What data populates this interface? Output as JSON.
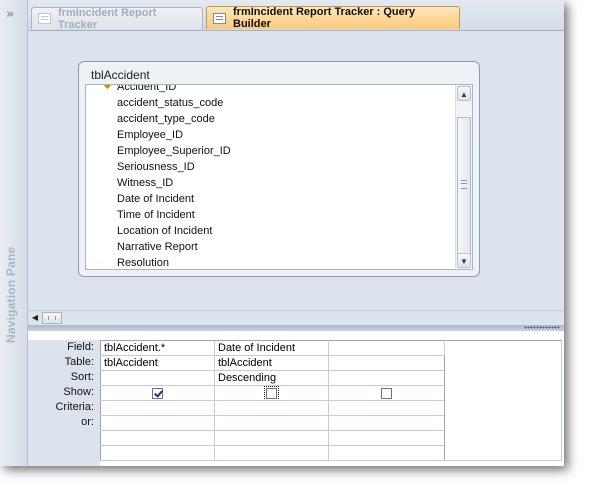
{
  "nav_pane": {
    "toggle_icon": "chevron-double-right-icon",
    "toggle_glyph": "»",
    "label": "Navigation Pane"
  },
  "tabs": [
    {
      "label": "frmIncident Report Tracker",
      "active": false,
      "icon": "form-icon"
    },
    {
      "label": "frmIncident Report Tracker : Query Builder",
      "active": true,
      "icon": "query-icon"
    }
  ],
  "field_list": {
    "title": "tblAccident",
    "primary_key_icon": "key-icon",
    "fields": [
      "Accident_ID",
      "accident_status_code",
      "accident_type_code",
      "Employee_ID",
      "Employee_Superior_ID",
      "Seriousness_ID",
      "Witness_ID",
      "Date of Incident",
      "Time of Incident",
      "Location of Incident",
      "Narrative Report",
      "Resolution"
    ],
    "scroll_up_glyph": "▲",
    "scroll_down_glyph": "▼"
  },
  "hscroll": {
    "left_glyph": "◀"
  },
  "design_grid": {
    "row_labels": [
      "Field:",
      "Table:",
      "Sort:",
      "Show:",
      "Criteria:",
      "or:"
    ],
    "columns": [
      {
        "field": "tblAccident.*",
        "table": "tblAccident",
        "sort": "",
        "show": true,
        "criteria": "",
        "or": ""
      },
      {
        "field": "Date of Incident",
        "table": "tblAccident",
        "sort": "Descending",
        "show": false,
        "criteria": "",
        "or": ""
      },
      {
        "field": "",
        "table": "",
        "sort": "",
        "show": false,
        "criteria": "",
        "or": ""
      }
    ]
  },
  "colors": {
    "active_tab": "#fbc97a",
    "background": "#dde3ec",
    "border": "#8d9cb2"
  }
}
